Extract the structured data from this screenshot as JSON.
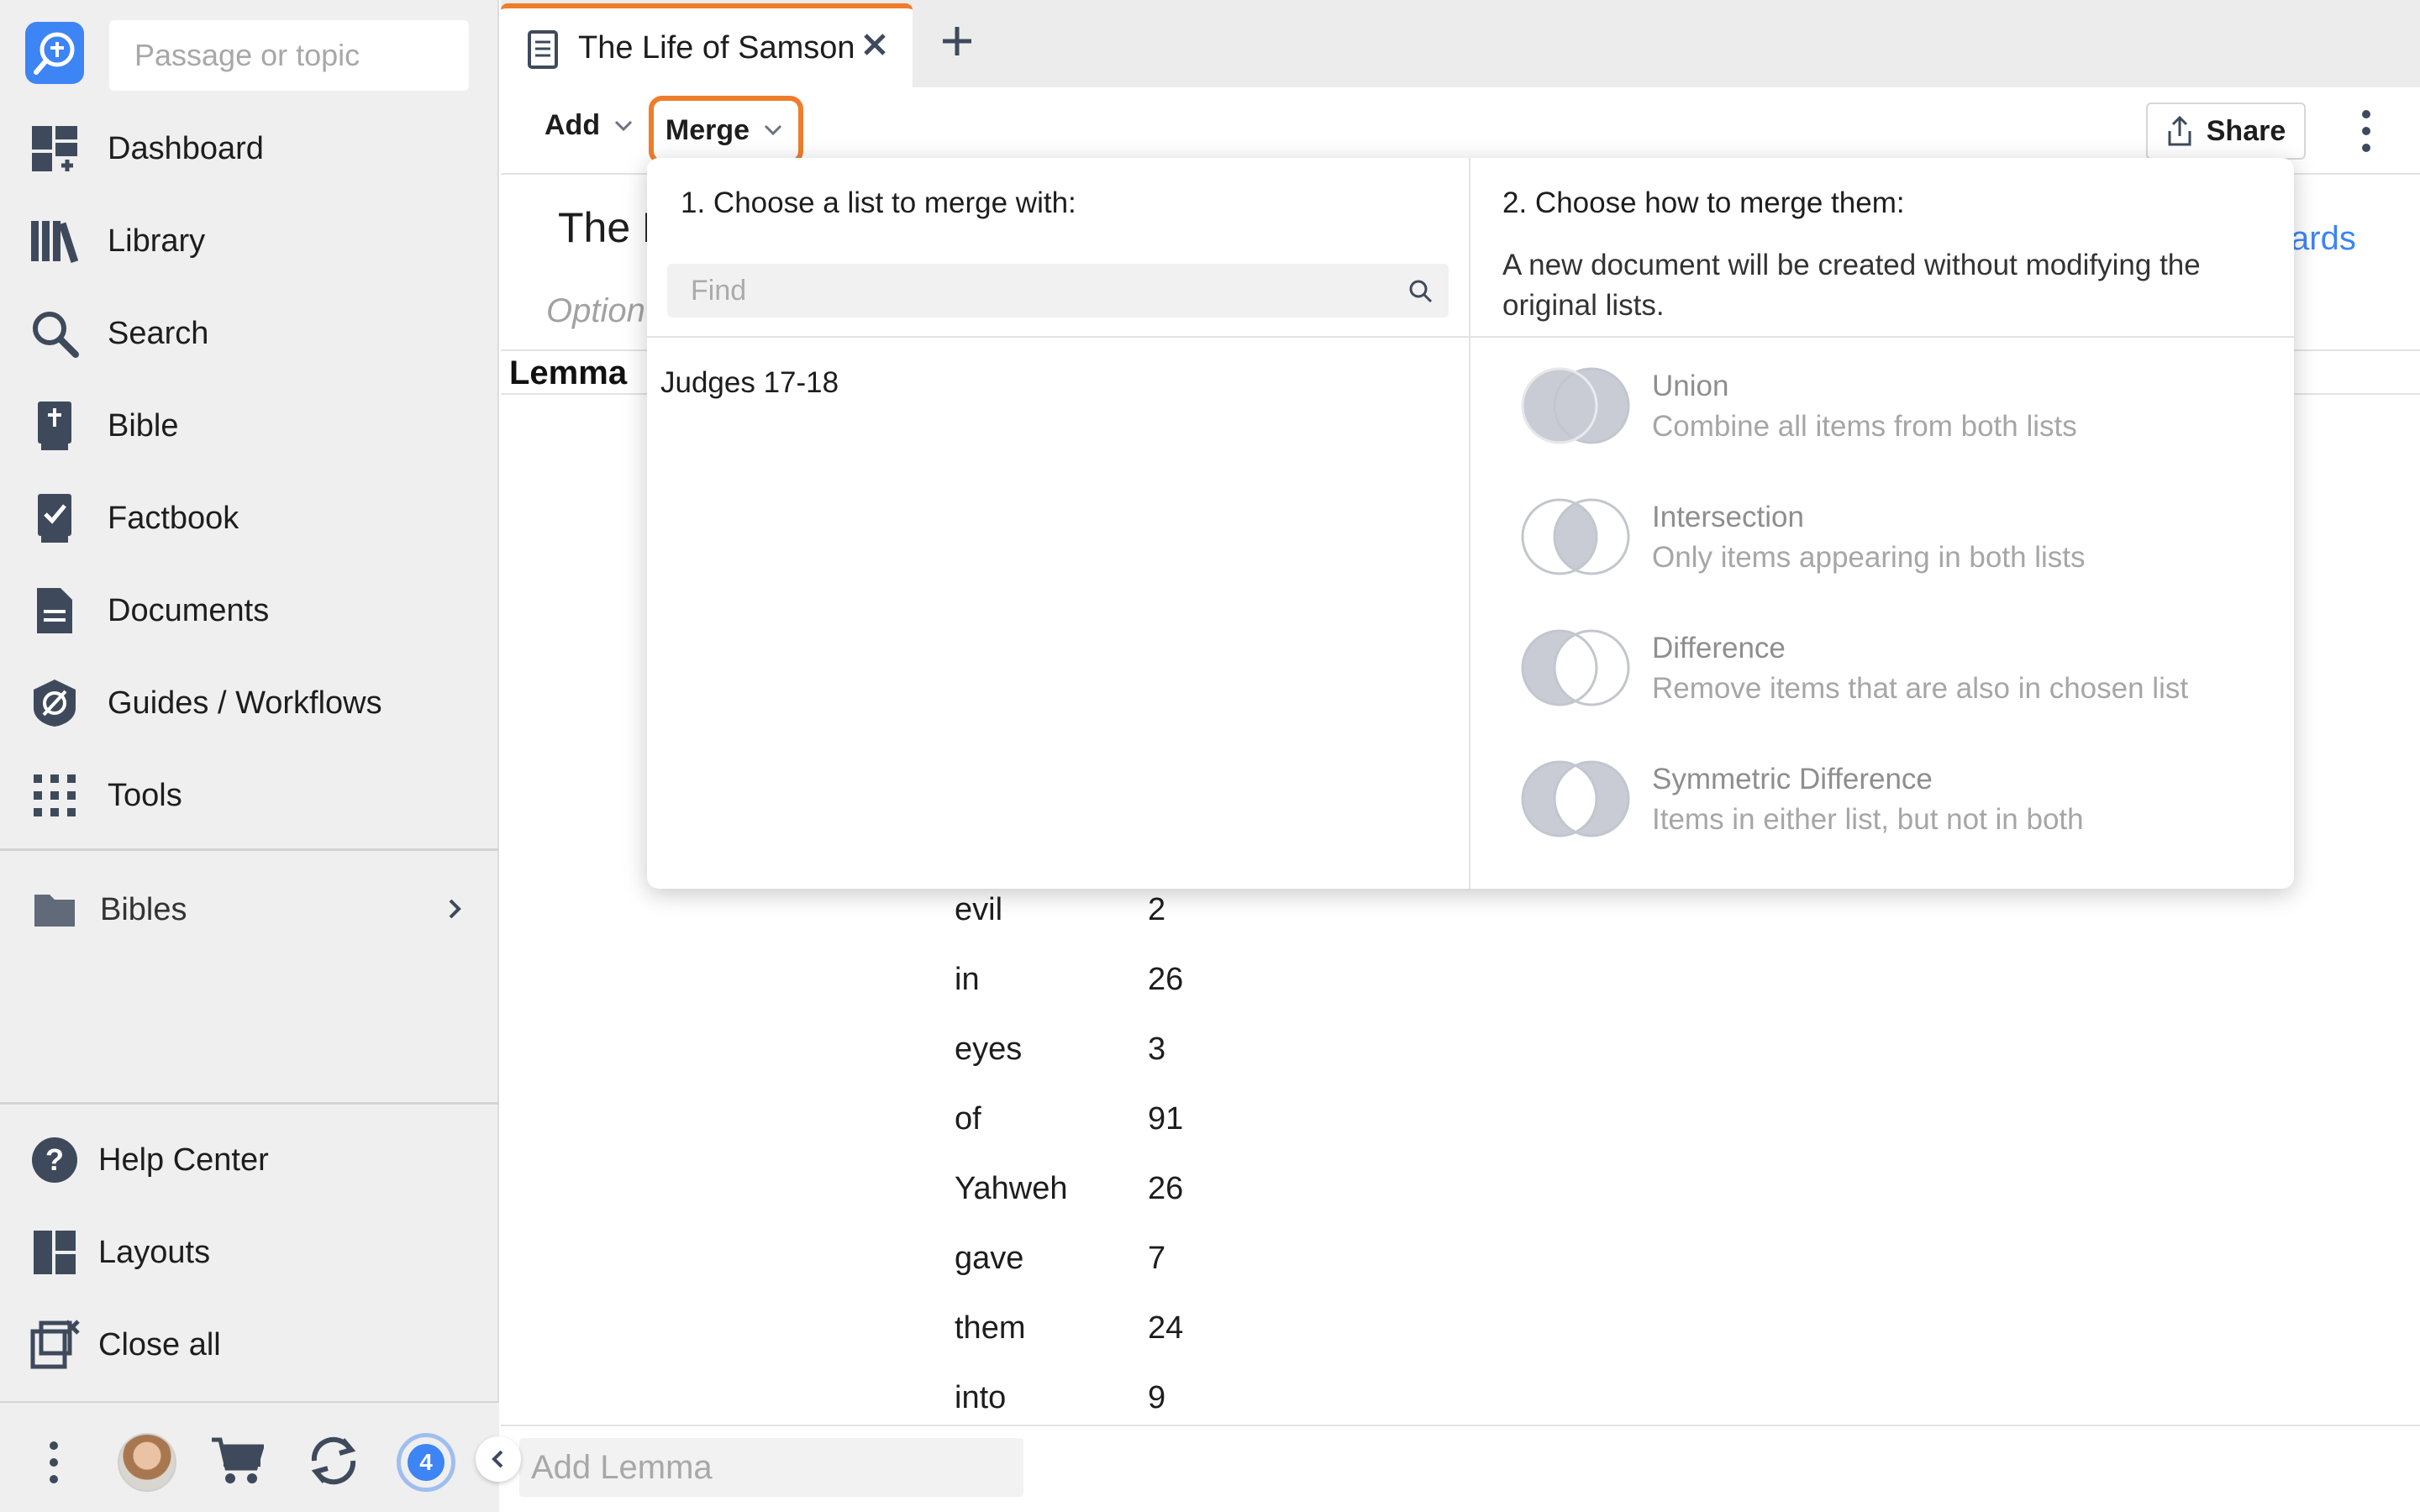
{
  "sidebar": {
    "search_placeholder": "Passage or topic",
    "nav": [
      {
        "label": "Dashboard",
        "icon": "dashboard-icon"
      },
      {
        "label": "Library",
        "icon": "library-icon"
      },
      {
        "label": "Search",
        "icon": "search-icon"
      },
      {
        "label": "Bible",
        "icon": "bible-icon"
      },
      {
        "label": "Factbook",
        "icon": "factbook-icon"
      },
      {
        "label": "Documents",
        "icon": "documents-icon"
      },
      {
        "label": "Guides / Workflows",
        "icon": "guides-icon"
      },
      {
        "label": "Tools",
        "icon": "tools-icon"
      }
    ],
    "bibles_label": "Bibles",
    "bottom": [
      {
        "label": "Help Center",
        "icon": "help-icon"
      },
      {
        "label": "Layouts",
        "icon": "layouts-icon"
      },
      {
        "label": "Close all",
        "icon": "close-all-icon"
      }
    ],
    "footer": {
      "badge_count": "4"
    }
  },
  "tab": {
    "title": "The Life of Samson"
  },
  "toolbar": {
    "add_label": "Add",
    "merge_label": "Merge",
    "share_label": "Share"
  },
  "document": {
    "title_partial": "The L",
    "link_partial": "ards",
    "option_partial": "Option",
    "column_header": "Lemma",
    "rows": [
      {
        "word": "evil",
        "count": "2"
      },
      {
        "word": "in",
        "count": "26"
      },
      {
        "word": "eyes",
        "count": "3"
      },
      {
        "word": "of",
        "count": "91"
      },
      {
        "word": "Yahweh",
        "count": "26"
      },
      {
        "word": "gave",
        "count": "7"
      },
      {
        "word": "them",
        "count": "24"
      },
      {
        "word": "into",
        "count": "9"
      }
    ],
    "add_lemma_placeholder": "Add Lemma"
  },
  "merge_popup": {
    "left_heading": "1. Choose a list to merge with:",
    "find_placeholder": "Find",
    "lists": [
      "Judges 17-18"
    ],
    "right_heading": "2. Choose how to merge them:",
    "description": "A new document will be created without modifying the original lists.",
    "options": [
      {
        "title": "Union",
        "subtitle": "Combine all items from both lists"
      },
      {
        "title": "Intersection",
        "subtitle": "Only items appearing in both lists"
      },
      {
        "title": "Difference",
        "subtitle": "Remove items that are also in chosen list"
      },
      {
        "title": "Symmetric Difference",
        "subtitle": "Items in either list, but not in both"
      }
    ]
  },
  "colors": {
    "accent_orange": "#ef7d2b",
    "brand_blue": "#3d84f5",
    "icon_slate": "#3e4a5c"
  }
}
